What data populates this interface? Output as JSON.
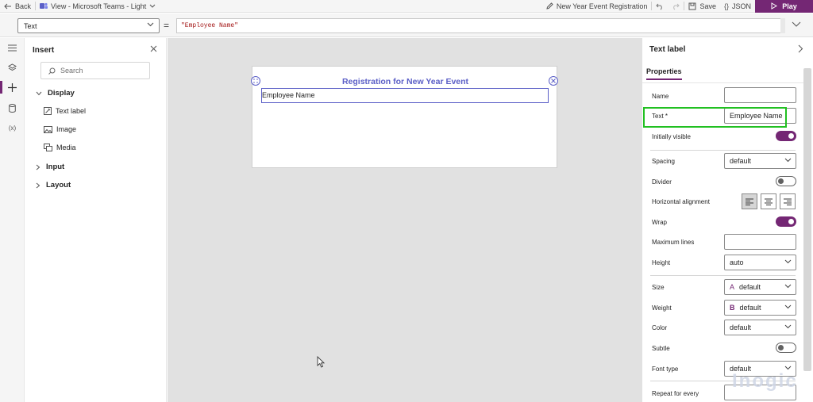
{
  "topbar": {
    "back_label": "Back",
    "view_label": "View - Microsoft Teams - Light",
    "app_name": "New Year Event Registration",
    "save_label": "Save",
    "json_label": "JSON",
    "play_label": "Play"
  },
  "formula_bar": {
    "property": "Text",
    "equals": "=",
    "formula": "\"Employee Name\""
  },
  "insert_pane": {
    "title": "Insert",
    "search_placeholder": "Search",
    "groups": [
      {
        "label": "Display",
        "expanded": true,
        "items": [
          "Text label",
          "Image",
          "Media"
        ]
      },
      {
        "label": "Input",
        "expanded": false
      },
      {
        "label": "Layout",
        "expanded": false
      }
    ]
  },
  "canvas": {
    "screen_title": "Registration for New Year Event",
    "selected_label_text": "Employee Name"
  },
  "properties": {
    "title": "Text label",
    "tab": "Properties",
    "name_label": "Name",
    "name_value": "",
    "text_label": "Text *",
    "text_value": "Employee Name",
    "visible_label": "Initially visible",
    "visible_on": true,
    "spacing_label": "Spacing",
    "spacing_value": "default",
    "divider_label": "Divider",
    "divider_on": false,
    "halign_label": "Horizontal alignment",
    "halign_value": "left",
    "wrap_label": "Wrap",
    "wrap_on": true,
    "maxlines_label": "Maximum lines",
    "maxlines_value": "",
    "height_label": "Height",
    "height_value": "auto",
    "size_label": "Size",
    "size_icon_text": "A",
    "size_value": "default",
    "weight_label": "Weight",
    "weight_icon_text": "B",
    "weight_value": "default",
    "color_label": "Color",
    "color_value": "default",
    "subtle_label": "Subtle",
    "subtle_on": false,
    "fonttype_label": "Font type",
    "fonttype_value": "default",
    "repeat_label": "Repeat for every",
    "repeat_value": ""
  },
  "colors": {
    "accent": "#742774",
    "selection": "#5b5fc7",
    "highlight": "#21c021"
  },
  "watermark": "Inogic"
}
